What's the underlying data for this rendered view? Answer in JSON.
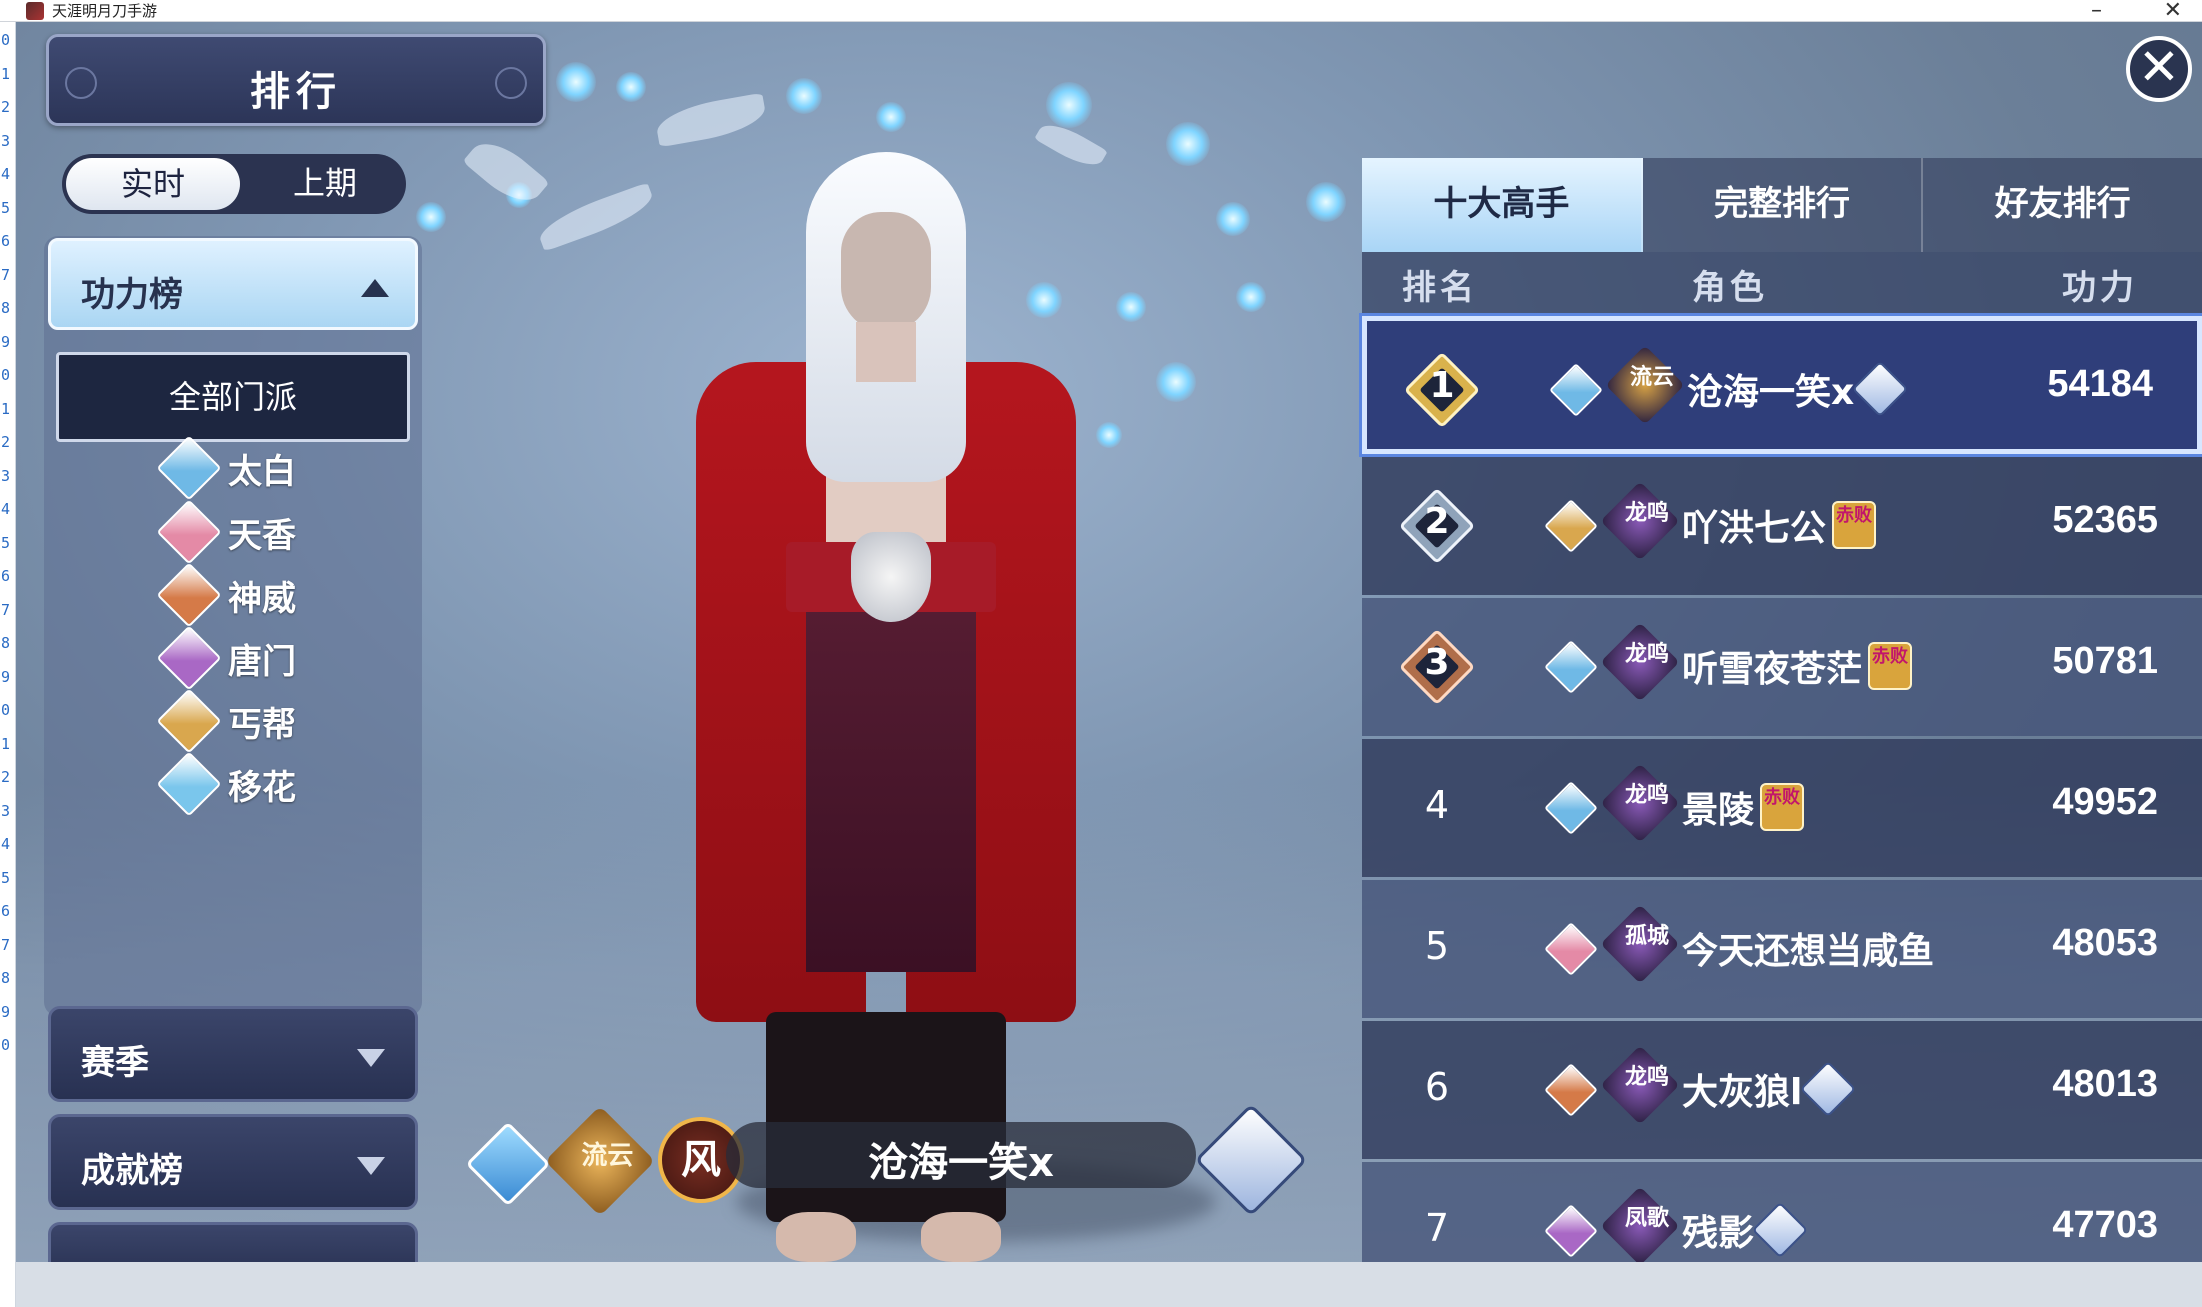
{
  "window": {
    "title": "天涯明月刀手游"
  },
  "gutter_numbers": [
    "0",
    "1",
    "2",
    "3",
    "4",
    "5",
    "6",
    "7",
    "8",
    "9",
    "0",
    "1",
    "2",
    "3",
    "4",
    "5",
    "6",
    "7",
    "8",
    "9",
    "0",
    "1",
    "2",
    "3",
    "4",
    "5",
    "6",
    "7",
    "8",
    "9",
    "0"
  ],
  "panel": {
    "title": "排行"
  },
  "period_toggle": {
    "active": "实时",
    "other": "上期"
  },
  "categories": {
    "open": {
      "label": "功力榜"
    },
    "sects": {
      "all": "全部门派",
      "items": [
        {
          "name": "太白",
          "color": "#6fb9e6"
        },
        {
          "name": "天香",
          "color": "#e48aa6"
        },
        {
          "name": "神威",
          "color": "#d57a48"
        },
        {
          "name": "唐门",
          "color": "#a968c5"
        },
        {
          "name": "丐帮",
          "color": "#d9a74e"
        },
        {
          "name": "移花",
          "color": "#7ac6ec"
        }
      ]
    },
    "season": {
      "label": "赛季"
    },
    "achievement": {
      "label": "成就榜"
    }
  },
  "character": {
    "name": "沧海一笑x",
    "guild": "流云",
    "faction": "风"
  },
  "ranking": {
    "tabs": [
      "十大高手",
      "完整排行",
      "好友排行"
    ],
    "active_tab": "十大高手",
    "columns": {
      "rank": "排名",
      "role": "角色",
      "power": "功力"
    },
    "rows": [
      {
        "rank": "1",
        "name": "沧海一笑x",
        "guild": "流云",
        "guild_color": "#d7a245",
        "sect_color": "#6fb9e6",
        "badge": "lotus",
        "power": "54184"
      },
      {
        "rank": "2",
        "name": "吖洪七公",
        "guild": "龙鸣",
        "guild_color": "#8a5ab8",
        "sect_color": "#d9a74e",
        "badge": "赤败",
        "power": "52365"
      },
      {
        "rank": "3",
        "name": "听雪夜苍茫",
        "guild": "龙鸣",
        "guild_color": "#8a5ab8",
        "sect_color": "#6fb9e6",
        "badge": "赤败",
        "power": "50781"
      },
      {
        "rank": "4",
        "name": "景陵",
        "guild": "龙鸣",
        "guild_color": "#8a5ab8",
        "sect_color": "#6fb9e6",
        "badge": "赤败",
        "power": "49952"
      },
      {
        "rank": "5",
        "name": "今天还想当咸鱼",
        "guild": "孤城",
        "guild_color": "#8a5ab8",
        "sect_color": "#e48aa6",
        "badge": "",
        "power": "48053"
      },
      {
        "rank": "6",
        "name": "大灰狼l",
        "guild": "龙鸣",
        "guild_color": "#8a5ab8",
        "sect_color": "#d57a48",
        "badge": "lotus",
        "power": "48013"
      },
      {
        "rank": "7",
        "name": "残影",
        "guild": "凤歌",
        "guild_color": "#8a5ab8",
        "sect_color": "#a968c5",
        "badge": "lotus",
        "power": "47703"
      }
    ]
  }
}
